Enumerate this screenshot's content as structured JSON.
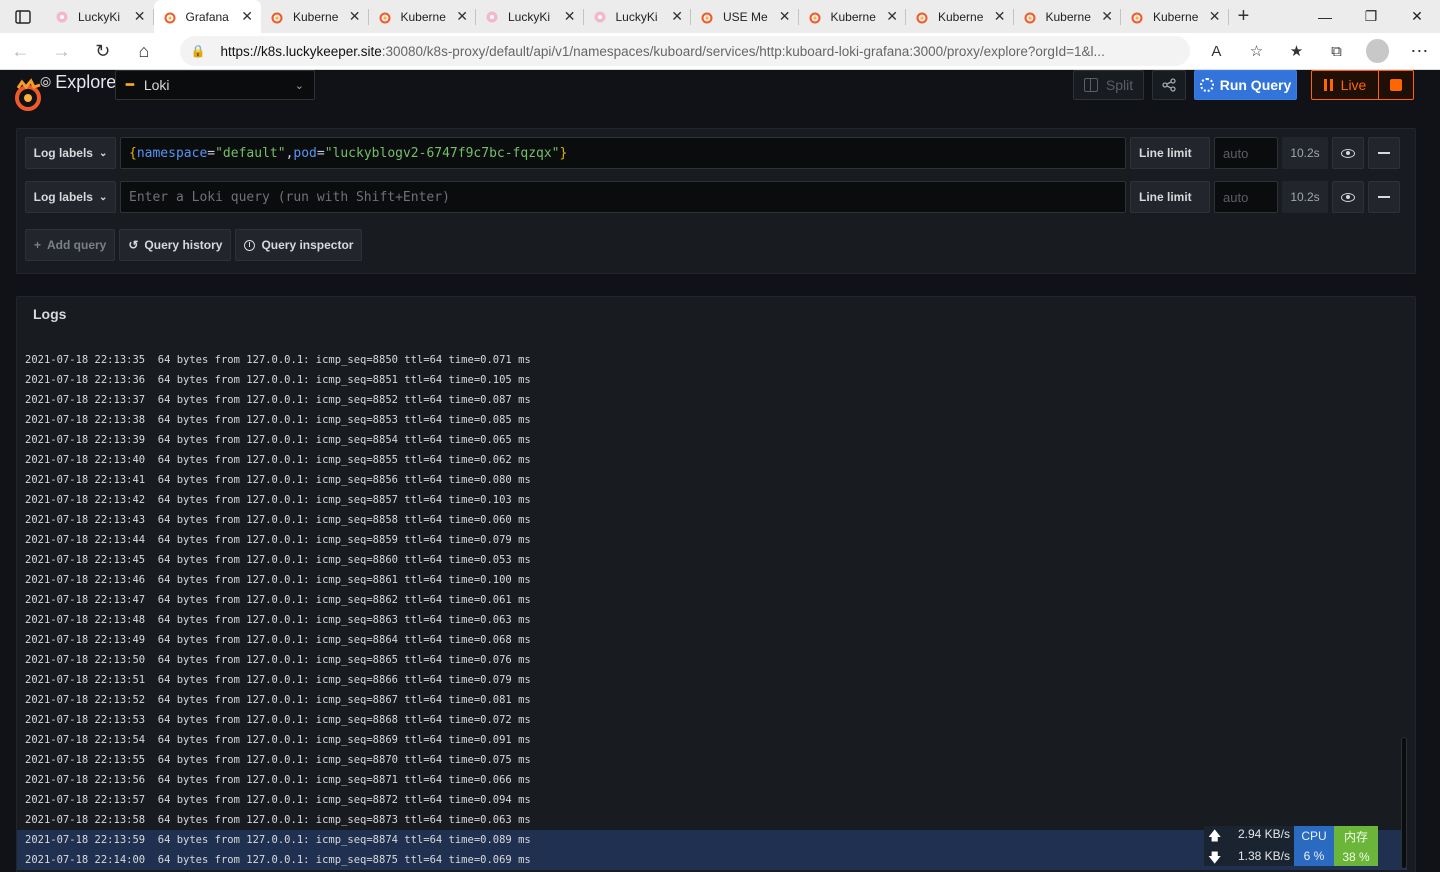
{
  "browser": {
    "tabs": [
      {
        "title": "LuckyKi",
        "icon": "lucky-icon",
        "active": false
      },
      {
        "title": "Grafana",
        "icon": "grafana-icon",
        "active": true
      },
      {
        "title": "Kuberne",
        "icon": "grafana-icon",
        "active": false
      },
      {
        "title": "Kuberne",
        "icon": "grafana-icon",
        "active": false
      },
      {
        "title": "LuckyKi",
        "icon": "lucky-icon",
        "active": false
      },
      {
        "title": "LuckyKi",
        "icon": "lucky-icon",
        "active": false
      },
      {
        "title": "USE Me",
        "icon": "grafana-icon",
        "active": false
      },
      {
        "title": "Kuberne",
        "icon": "grafana-icon",
        "active": false
      },
      {
        "title": "Kuberne",
        "icon": "grafana-icon",
        "active": false
      },
      {
        "title": "Kuberne",
        "icon": "grafana-icon",
        "active": false
      },
      {
        "title": "Kuberne",
        "icon": "grafana-icon",
        "active": false
      }
    ],
    "url_host": "https://k8s.luckykeeper.site",
    "url_rest": ":30080/k8s-proxy/default/api/v1/namespaces/kuboard/services/http:kuboard-loki-grafana:3000/proxy/explore?orgId=1&l..."
  },
  "explore": {
    "title": "Explore",
    "datasource": "Loki",
    "split_label": "Split",
    "run_query_label": "Run Query",
    "live_label": "Live",
    "colors": {
      "accent": "#3274d9",
      "live": "#ff6600"
    }
  },
  "queries": [
    {
      "labels_button": "Log labels",
      "brace_open": "{",
      "k1": "namespace",
      "eq1": "=",
      "v1": "\"default\"",
      "comma": ",",
      "k2": "pod",
      "eq2": "=",
      "v2": "\"luckyblogv2-6747f9c7bc-fqzqx\"",
      "brace_close": "}",
      "line_limit_label": "Line limit",
      "line_limit_placeholder": "auto",
      "time": "10.2s"
    },
    {
      "labels_button": "Log labels",
      "placeholder": "Enter a Loki query (run with Shift+Enter)",
      "line_limit_label": "Line limit",
      "line_limit_placeholder": "auto",
      "time": "10.2s"
    }
  ],
  "actions": {
    "add_query": "Add query",
    "query_history": "Query history",
    "query_inspector": "Query inspector"
  },
  "logs": {
    "title": "Logs",
    "lines": [
      "2021-07-18 22:13:35  64 bytes from 127.0.0.1: icmp_seq=8850 ttl=64 time=0.071 ms",
      "2021-07-18 22:13:36  64 bytes from 127.0.0.1: icmp_seq=8851 ttl=64 time=0.105 ms",
      "2021-07-18 22:13:37  64 bytes from 127.0.0.1: icmp_seq=8852 ttl=64 time=0.087 ms",
      "2021-07-18 22:13:38  64 bytes from 127.0.0.1: icmp_seq=8853 ttl=64 time=0.085 ms",
      "2021-07-18 22:13:39  64 bytes from 127.0.0.1: icmp_seq=8854 ttl=64 time=0.065 ms",
      "2021-07-18 22:13:40  64 bytes from 127.0.0.1: icmp_seq=8855 ttl=64 time=0.062 ms",
      "2021-07-18 22:13:41  64 bytes from 127.0.0.1: icmp_seq=8856 ttl=64 time=0.080 ms",
      "2021-07-18 22:13:42  64 bytes from 127.0.0.1: icmp_seq=8857 ttl=64 time=0.103 ms",
      "2021-07-18 22:13:43  64 bytes from 127.0.0.1: icmp_seq=8858 ttl=64 time=0.060 ms",
      "2021-07-18 22:13:44  64 bytes from 127.0.0.1: icmp_seq=8859 ttl=64 time=0.079 ms",
      "2021-07-18 22:13:45  64 bytes from 127.0.0.1: icmp_seq=8860 ttl=64 time=0.053 ms",
      "2021-07-18 22:13:46  64 bytes from 127.0.0.1: icmp_seq=8861 ttl=64 time=0.100 ms",
      "2021-07-18 22:13:47  64 bytes from 127.0.0.1: icmp_seq=8862 ttl=64 time=0.061 ms",
      "2021-07-18 22:13:48  64 bytes from 127.0.0.1: icmp_seq=8863 ttl=64 time=0.063 ms",
      "2021-07-18 22:13:49  64 bytes from 127.0.0.1: icmp_seq=8864 ttl=64 time=0.068 ms",
      "2021-07-18 22:13:50  64 bytes from 127.0.0.1: icmp_seq=8865 ttl=64 time=0.076 ms",
      "2021-07-18 22:13:51  64 bytes from 127.0.0.1: icmp_seq=8866 ttl=64 time=0.079 ms",
      "2021-07-18 22:13:52  64 bytes from 127.0.0.1: icmp_seq=8867 ttl=64 time=0.081 ms",
      "2021-07-18 22:13:53  64 bytes from 127.0.0.1: icmp_seq=8868 ttl=64 time=0.072 ms",
      "2021-07-18 22:13:54  64 bytes from 127.0.0.1: icmp_seq=8869 ttl=64 time=0.091 ms",
      "2021-07-18 22:13:55  64 bytes from 127.0.0.1: icmp_seq=8870 ttl=64 time=0.075 ms",
      "2021-07-18 22:13:56  64 bytes from 127.0.0.1: icmp_seq=8871 ttl=64 time=0.066 ms",
      "2021-07-18 22:13:57  64 bytes from 127.0.0.1: icmp_seq=8872 ttl=64 time=0.094 ms",
      "2021-07-18 22:13:58  64 bytes from 127.0.0.1: icmp_seq=8873 ttl=64 time=0.063 ms",
      "2021-07-18 22:13:59  64 bytes from 127.0.0.1: icmp_seq=8874 ttl=64 time=0.089 ms",
      "2021-07-18 22:14:00  64 bytes from 127.0.0.1: icmp_seq=8875 ttl=64 time=0.069 ms"
    ],
    "selected_from": 24
  },
  "netmon": {
    "up": "2.94 KB/s",
    "down": "1.38 KB/s",
    "cpu_label": "CPU",
    "cpu_value": "6 %",
    "mem_label": "内存",
    "mem_value": "38 %"
  }
}
